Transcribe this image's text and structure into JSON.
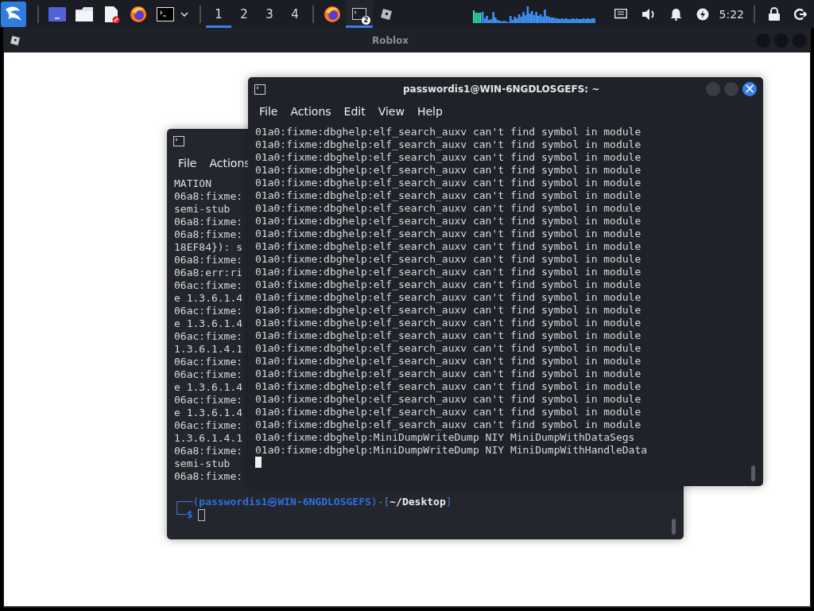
{
  "taskbar": {
    "workspaces": [
      {
        "label": "1",
        "selected": true
      },
      {
        "label": "2",
        "selected": false
      },
      {
        "label": "3",
        "selected": false
      },
      {
        "label": "4",
        "selected": false
      }
    ],
    "tasks": [
      {
        "kind": "browser",
        "selected": false
      },
      {
        "kind": "terminal",
        "badge": "2",
        "selected": true
      },
      {
        "kind": "roblox",
        "selected": false
      }
    ],
    "clock": "5:22"
  },
  "window": {
    "title": "Roblox"
  },
  "terminals": [
    {
      "menu": [
        "File",
        "Actions"
      ],
      "lines": [
        "MATION",
        "06a8:fixme:",
        "semi-stub",
        "06a8:fixme:",
        "06a8:fixme:",
        "18EF84}): s",
        "06a8:fixme:",
        "06a8:err:ri",
        "06ac:fixme:",
        "e 1.3.6.1.4",
        "06ac:fixme:",
        "e 1.3.6.1.4",
        "06ac:fixme:",
        "1.3.6.1.4.1",
        "06ac:fixme:",
        "06ac:fixme:",
        "e 1.3.6.1.4",
        "06ac:fixme:",
        "e 1.3.6.1.4",
        "06ac:fixme:",
        "1.3.6.1.4.1",
        "06a8:fixme:",
        "semi-stub",
        "06a8:fixme:"
      ],
      "prompt": {
        "lead": "┌──(",
        "user": "passwordis1㉿WIN-6NGDLOSGEFS",
        "mid": ")-[",
        "path": "~/Desktop",
        "tail": "]",
        "lead2": "└─",
        "sign": "$"
      },
      "cursor_filled": false
    },
    {
      "title": "passwordis1@WIN-6NGDLOSGEFS: ~",
      "close_label": "×",
      "menu": [
        "File",
        "Actions",
        "Edit",
        "View",
        "Help"
      ],
      "lines": [
        "01a0:fixme:dbghelp:elf_search_auxv can't find symbol in module",
        "01a0:fixme:dbghelp:elf_search_auxv can't find symbol in module",
        "01a0:fixme:dbghelp:elf_search_auxv can't find symbol in module",
        "01a0:fixme:dbghelp:elf_search_auxv can't find symbol in module",
        "01a0:fixme:dbghelp:elf_search_auxv can't find symbol in module",
        "01a0:fixme:dbghelp:elf_search_auxv can't find symbol in module",
        "01a0:fixme:dbghelp:elf_search_auxv can't find symbol in module",
        "01a0:fixme:dbghelp:elf_search_auxv can't find symbol in module",
        "01a0:fixme:dbghelp:elf_search_auxv can't find symbol in module",
        "01a0:fixme:dbghelp:elf_search_auxv can't find symbol in module",
        "01a0:fixme:dbghelp:elf_search_auxv can't find symbol in module",
        "01a0:fixme:dbghelp:elf_search_auxv can't find symbol in module",
        "01a0:fixme:dbghelp:elf_search_auxv can't find symbol in module",
        "01a0:fixme:dbghelp:elf_search_auxv can't find symbol in module",
        "01a0:fixme:dbghelp:elf_search_auxv can't find symbol in module",
        "01a0:fixme:dbghelp:elf_search_auxv can't find symbol in module",
        "01a0:fixme:dbghelp:elf_search_auxv can't find symbol in module",
        "01a0:fixme:dbghelp:elf_search_auxv can't find symbol in module",
        "01a0:fixme:dbghelp:elf_search_auxv can't find symbol in module",
        "01a0:fixme:dbghelp:elf_search_auxv can't find symbol in module",
        "01a0:fixme:dbghelp:elf_search_auxv can't find symbol in module",
        "01a0:fixme:dbghelp:elf_search_auxv can't find symbol in module",
        "01a0:fixme:dbghelp:elf_search_auxv can't find symbol in module",
        "01a0:fixme:dbghelp:elf_search_auxv can't find symbol in module",
        "01a0:fixme:dbghelp:MiniDumpWriteDump NIY MiniDumpWithDataSegs",
        "01a0:fixme:dbghelp:MiniDumpWriteDump NIY MiniDumpWithHandleData"
      ],
      "cursor_filled": true
    }
  ]
}
